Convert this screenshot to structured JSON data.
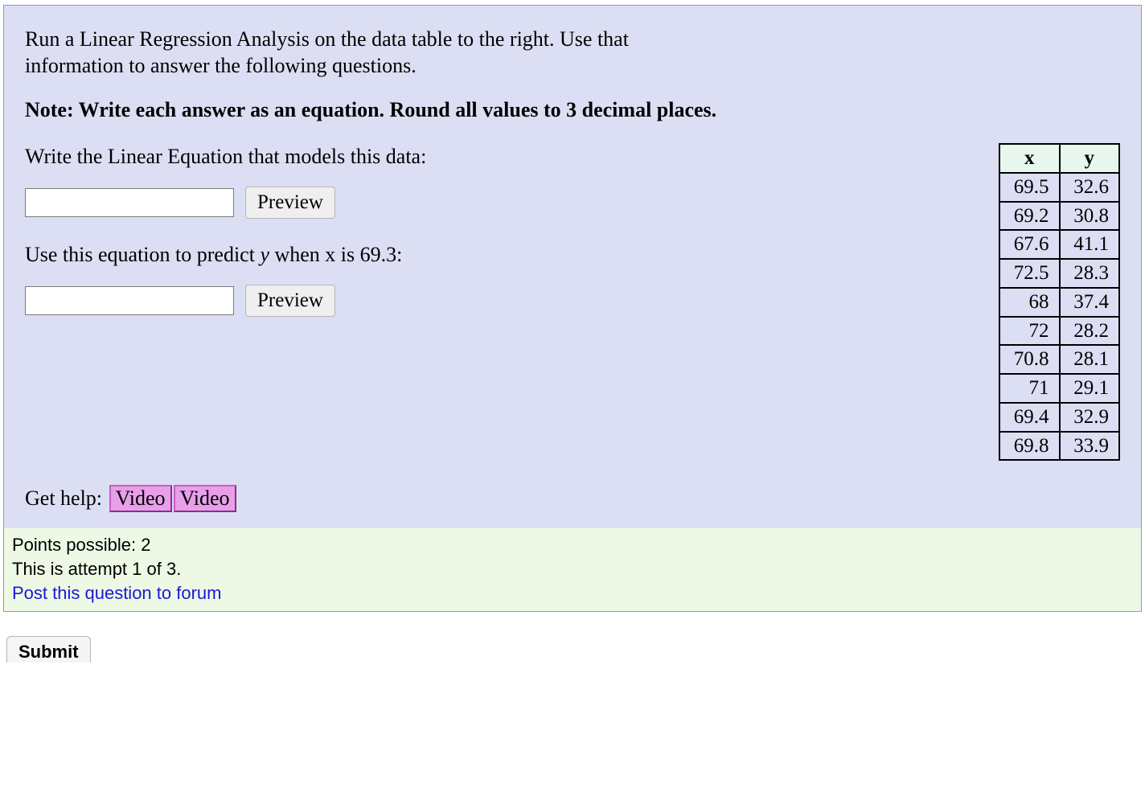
{
  "intro": "Run a Linear Regression Analysis on the data table to the right. Use that information to answer the following questions.",
  "note": "Note: Write each answer as an equation. Round all values to 3 decimal places.",
  "q1": {
    "prompt": "Write the Linear Equation that models this data:",
    "preview_label": "Preview"
  },
  "q2": {
    "prompt_pre": "Use this equation to predict ",
    "prompt_post": " when x is 69.3:",
    "y_var": "y",
    "preview_label": "Preview"
  },
  "table": {
    "headers": {
      "x": "x",
      "y": "y"
    },
    "rows": [
      {
        "x": "69.5",
        "y": "32.6"
      },
      {
        "x": "69.2",
        "y": "30.8"
      },
      {
        "x": "67.6",
        "y": "41.1"
      },
      {
        "x": "72.5",
        "y": "28.3"
      },
      {
        "x": "68",
        "y": "37.4"
      },
      {
        "x": "72",
        "y": "28.2"
      },
      {
        "x": "70.8",
        "y": "28.1"
      },
      {
        "x": "71",
        "y": "29.1"
      },
      {
        "x": "69.4",
        "y": "32.9"
      },
      {
        "x": "69.8",
        "y": "33.9"
      }
    ]
  },
  "help": {
    "label": "Get help:",
    "video1": "Video",
    "video2": "Video"
  },
  "footer": {
    "points": "Points possible: 2",
    "attempt": "This is attempt 1 of 3.",
    "forum": "Post this question to forum"
  },
  "submit_label": "Submit"
}
